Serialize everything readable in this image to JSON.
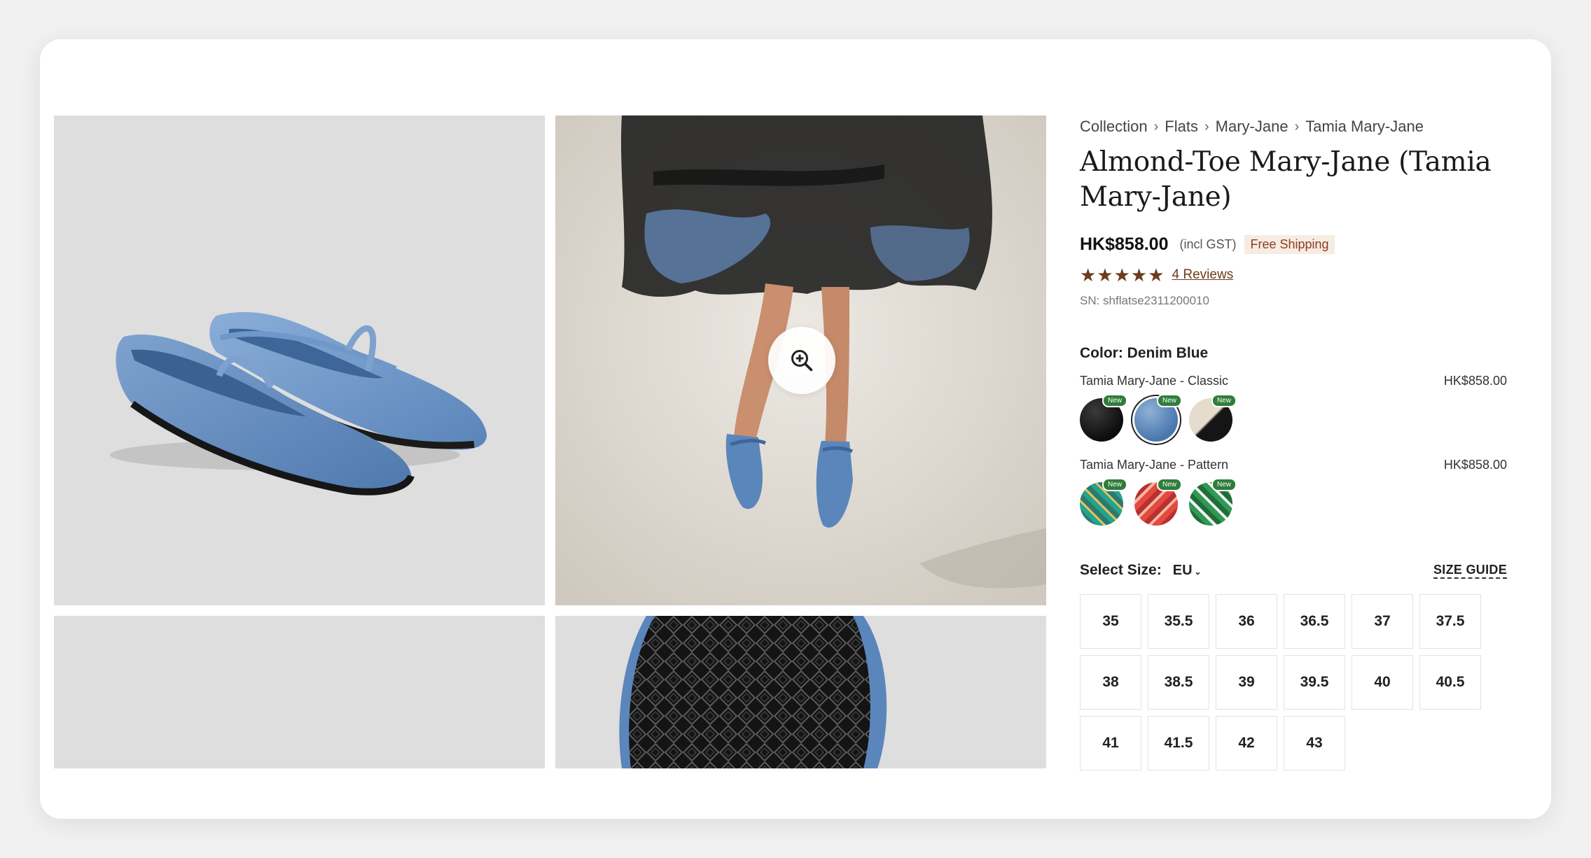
{
  "breadcrumb": [
    "Collection",
    "Flats",
    "Mary-Jane",
    "Tamia Mary-Jane"
  ],
  "product": {
    "title": "Almond-Toe Mary-Jane (Tamia Mary-Jane)",
    "price": "HK$858.00",
    "tax_note": "(incl GST)",
    "shipping_badge": "Free Shipping",
    "rating_stars": 5,
    "reviews_label": "4 Reviews",
    "sn": "SN: shflatse2311200010"
  },
  "color": {
    "label": "Color: Denim Blue",
    "groups": [
      {
        "name": "Tamia Mary-Jane - Classic",
        "price": "HK$858.00",
        "swatches": [
          {
            "color_name": "black",
            "badge": "New",
            "selected": false
          },
          {
            "color_name": "denim-blue",
            "badge": "New",
            "selected": true
          },
          {
            "color_name": "cream-black",
            "badge": "New",
            "selected": false
          }
        ]
      },
      {
        "name": "Tamia Mary-Jane - Pattern",
        "price": "HK$858.00",
        "swatches": [
          {
            "color_name": "teal-pattern",
            "badge": "New",
            "selected": false
          },
          {
            "color_name": "red-pattern",
            "badge": "New",
            "selected": false
          },
          {
            "color_name": "green-pattern",
            "badge": "New",
            "selected": false
          }
        ]
      }
    ]
  },
  "size": {
    "label": "Select Size:",
    "unit": "EU",
    "guide_label": "SIZE GUIDE",
    "options": [
      "35",
      "35.5",
      "36",
      "36.5",
      "37",
      "37.5",
      "38",
      "38.5",
      "39",
      "39.5",
      "40",
      "40.5",
      "41",
      "41.5",
      "42",
      "43"
    ]
  },
  "gallery": {
    "zoom_icon": "zoom-in-icon"
  },
  "colors": {
    "accent_brown": "#6e3b1e",
    "shipping_text": "#8a3f1f",
    "new_badge": "#2f7d3a",
    "denim": "#5b86bb"
  }
}
